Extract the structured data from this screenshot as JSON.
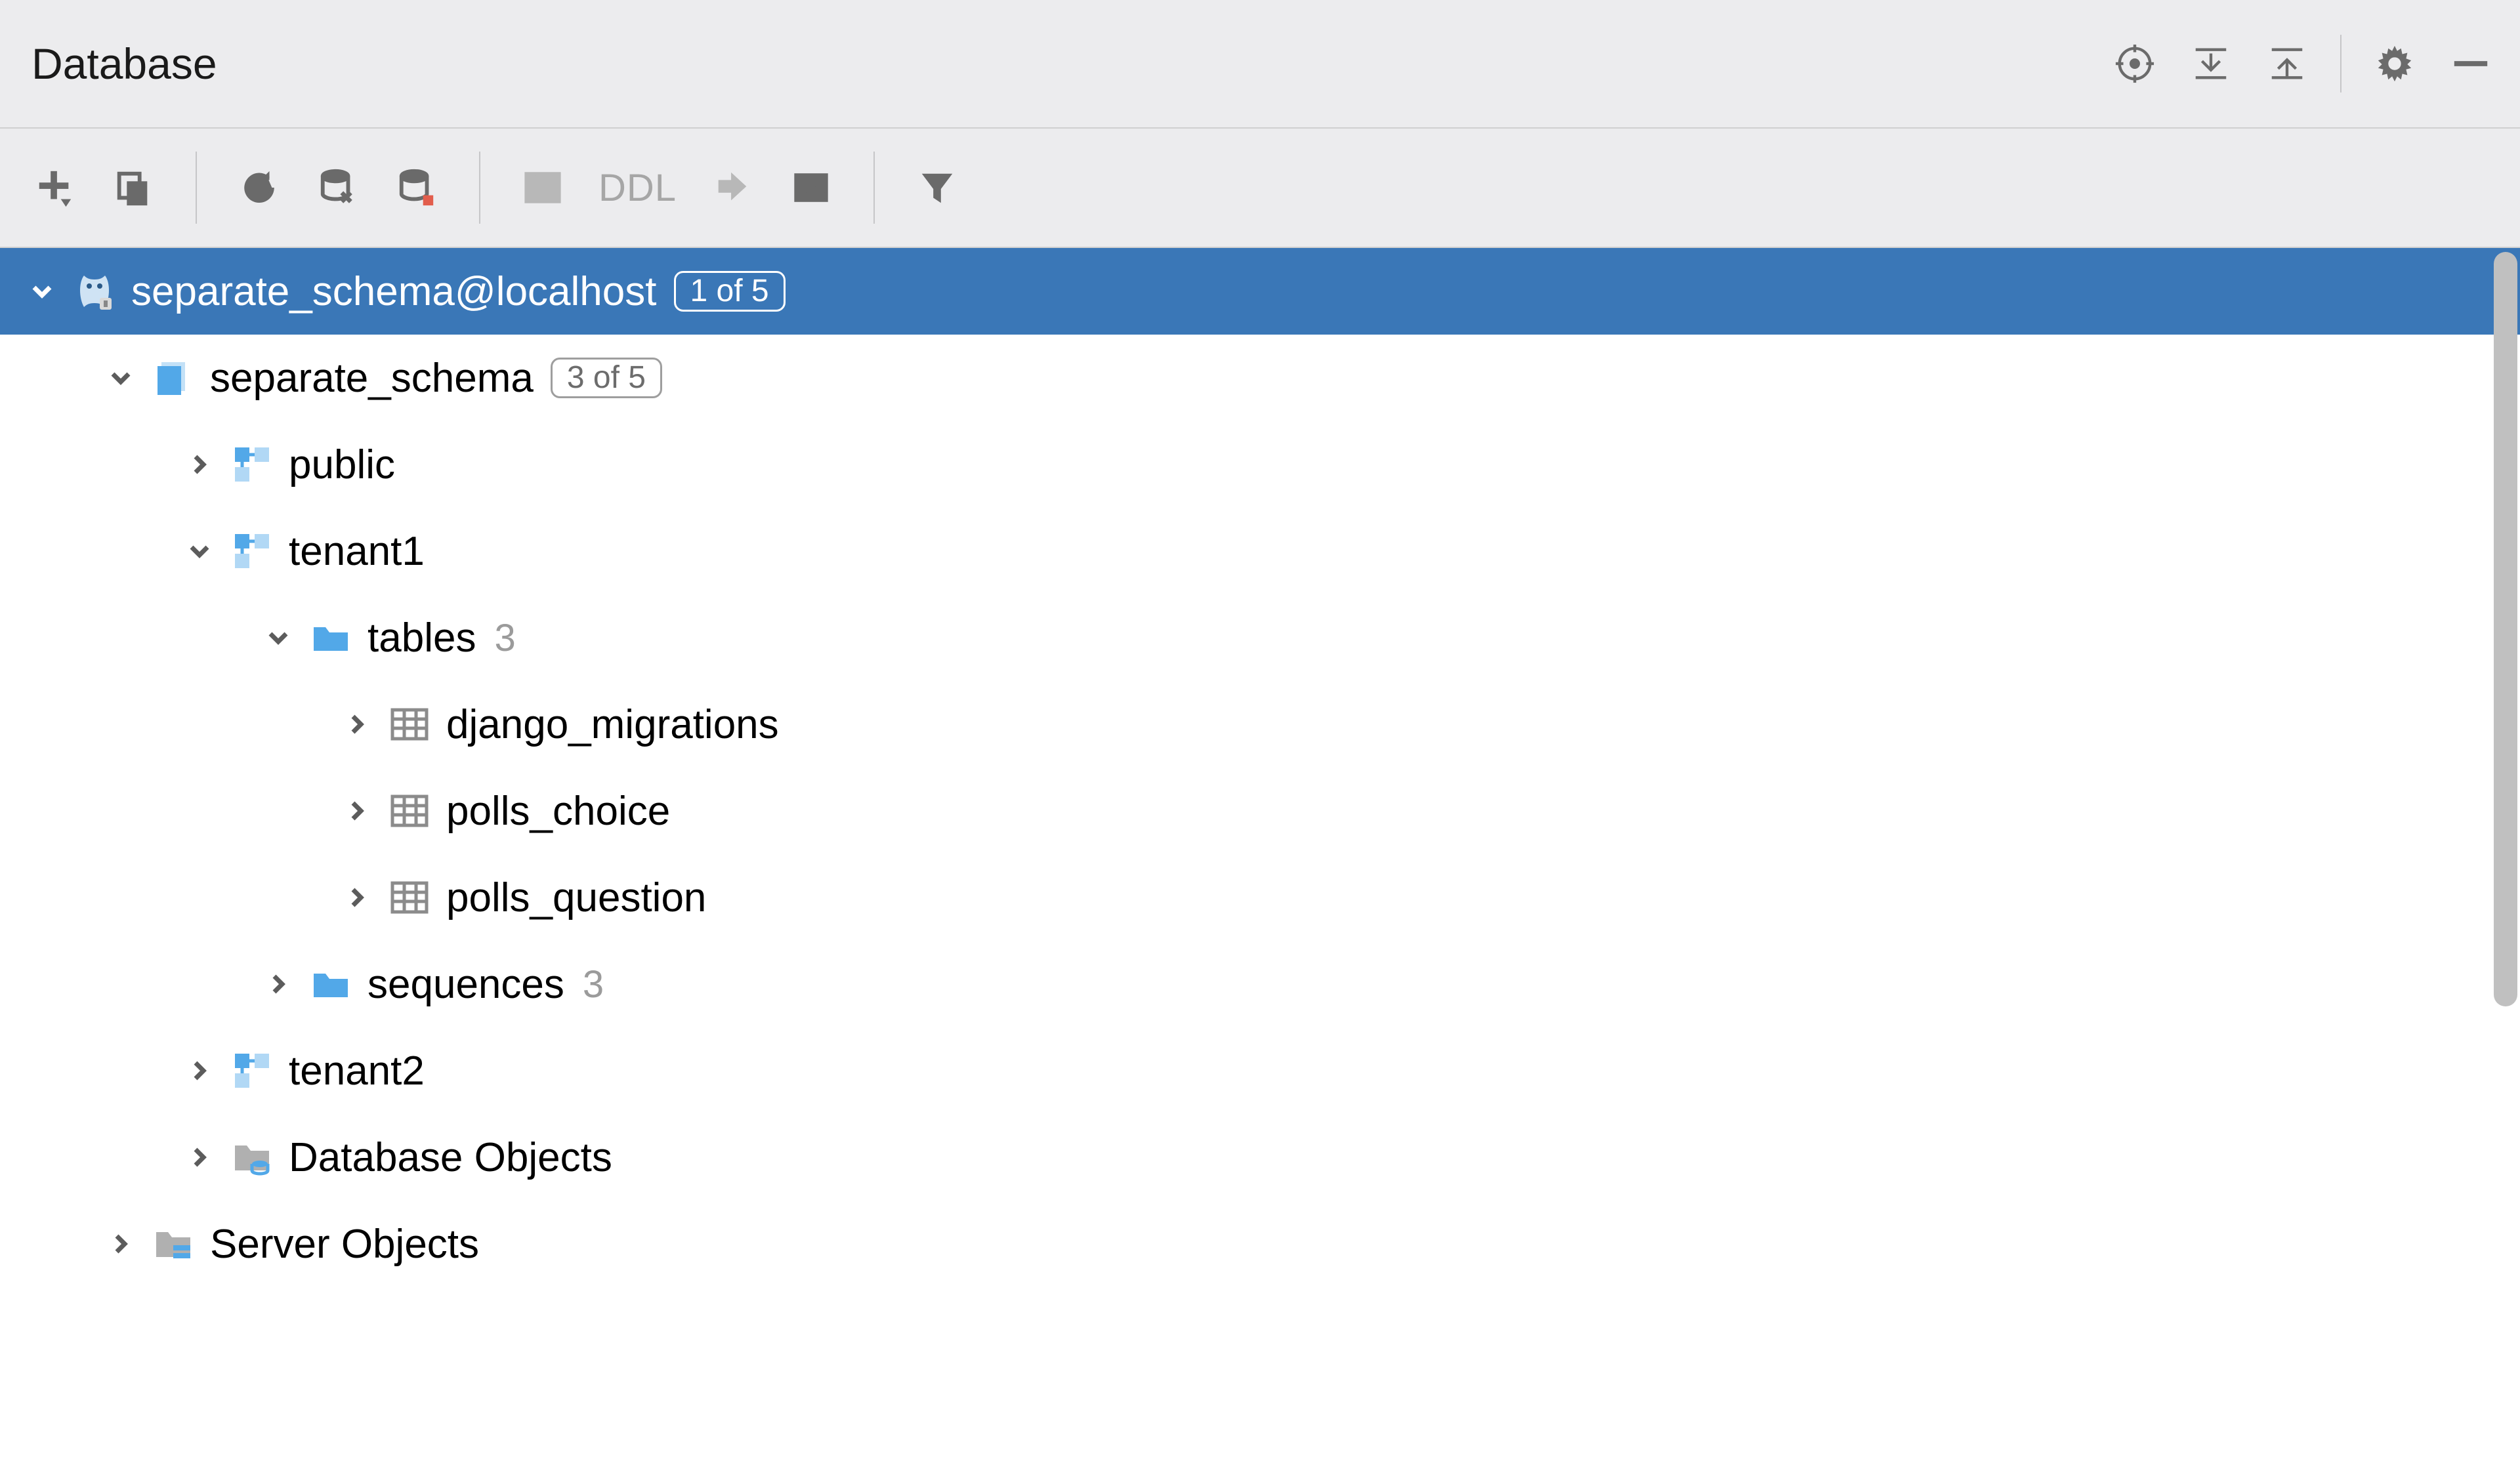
{
  "panel": {
    "title": "Database"
  },
  "toolbar": {
    "ddl_label": "DDL"
  },
  "tree": {
    "datasource": {
      "label": "separate_schema@localhost",
      "badge": "1 of 5",
      "expanded": true,
      "selected": true
    },
    "database": {
      "label": "separate_schema",
      "badge": "3 of 5",
      "expanded": true
    },
    "schemas": [
      {
        "name": "public",
        "expanded": false
      },
      {
        "name": "tenant1",
        "expanded": true,
        "groups": [
          {
            "name": "tables",
            "count": "3",
            "expanded": true,
            "items": [
              {
                "name": "django_migrations"
              },
              {
                "name": "polls_choice"
              },
              {
                "name": "polls_question"
              }
            ]
          },
          {
            "name": "sequences",
            "count": "3",
            "expanded": false
          }
        ]
      },
      {
        "name": "tenant2",
        "expanded": false
      }
    ],
    "db_objects": {
      "label": "Database Objects"
    },
    "server_objects": {
      "label": "Server Objects"
    }
  }
}
